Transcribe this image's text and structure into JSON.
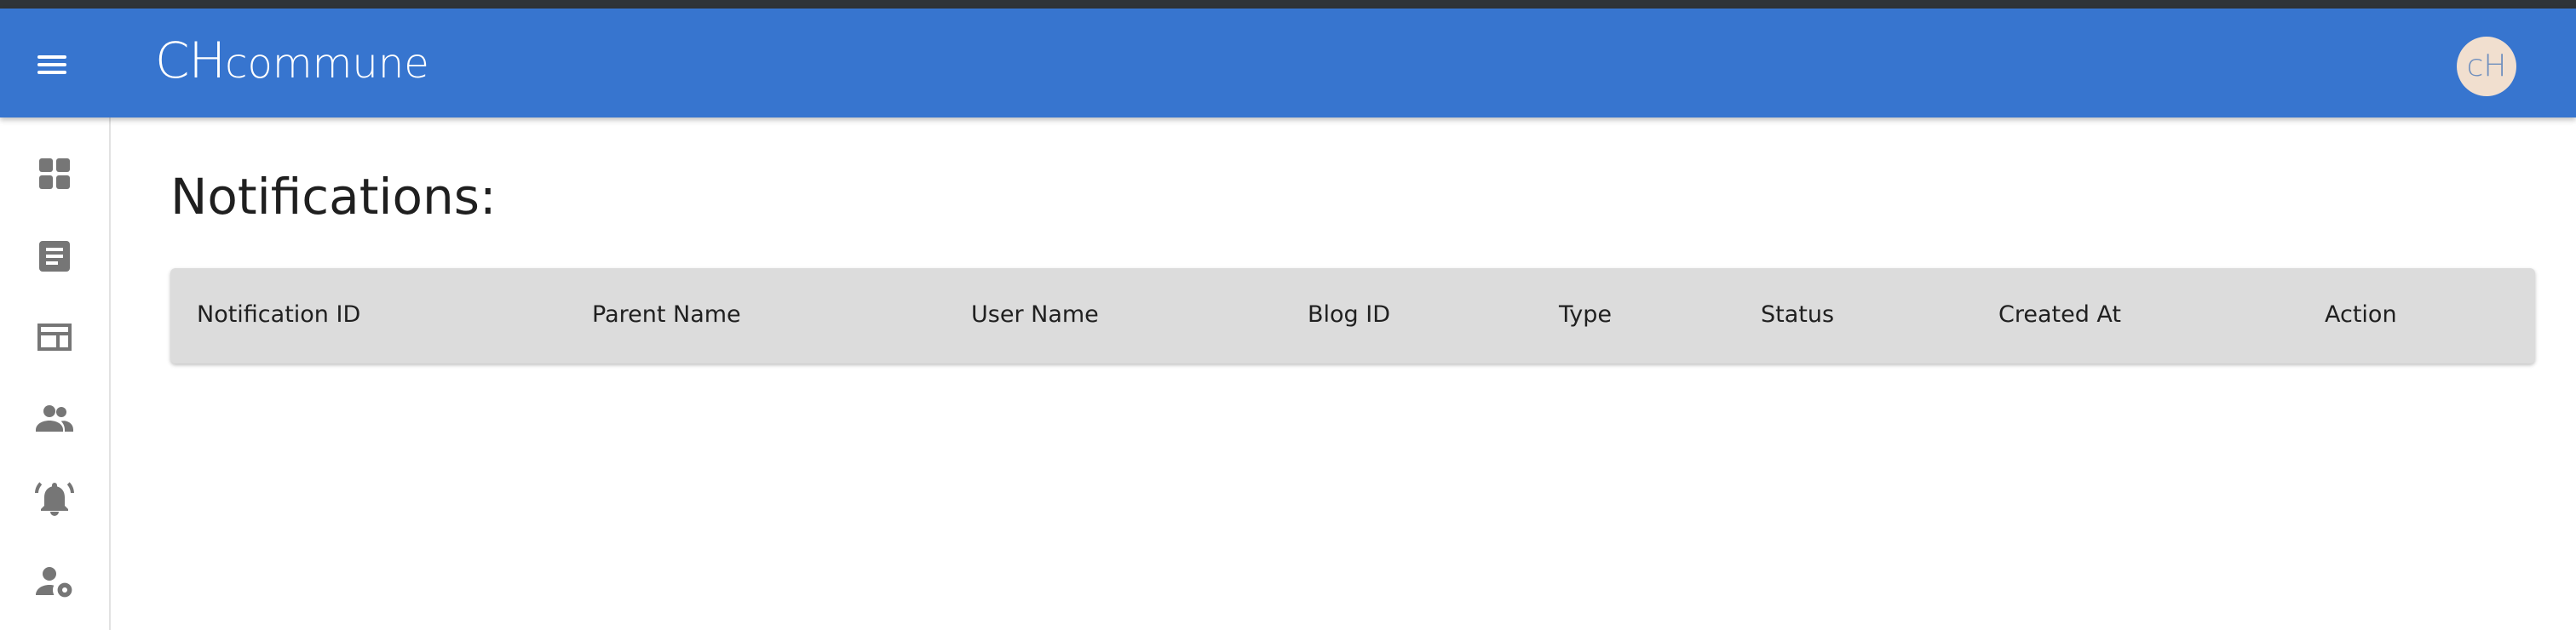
{
  "appbar": {
    "brand_initials": "CH",
    "brand_name": "commune",
    "avatar_text": "cH",
    "menu_icon": "menu-icon"
  },
  "colors": {
    "appbar": "#3775cf",
    "top_strip": "#2f3438",
    "table_header_bg": "#dcdcdc",
    "icon_gray": "#767676",
    "avatar_bg": "#f1dfcf",
    "avatar_text": "#6f8fbe"
  },
  "sidebar": {
    "items": [
      {
        "icon": "dashboard-icon"
      },
      {
        "icon": "article-icon"
      },
      {
        "icon": "web-layout-icon"
      },
      {
        "icon": "people-icon"
      },
      {
        "icon": "notification-bell-icon"
      },
      {
        "icon": "user-settings-icon"
      }
    ]
  },
  "main": {
    "title": "Notifications:",
    "table": {
      "columns": [
        "Notification ID",
        "Parent Name",
        "User Name",
        "Blog ID",
        "Type",
        "Status",
        "Created At",
        "Action"
      ],
      "rows": []
    }
  }
}
